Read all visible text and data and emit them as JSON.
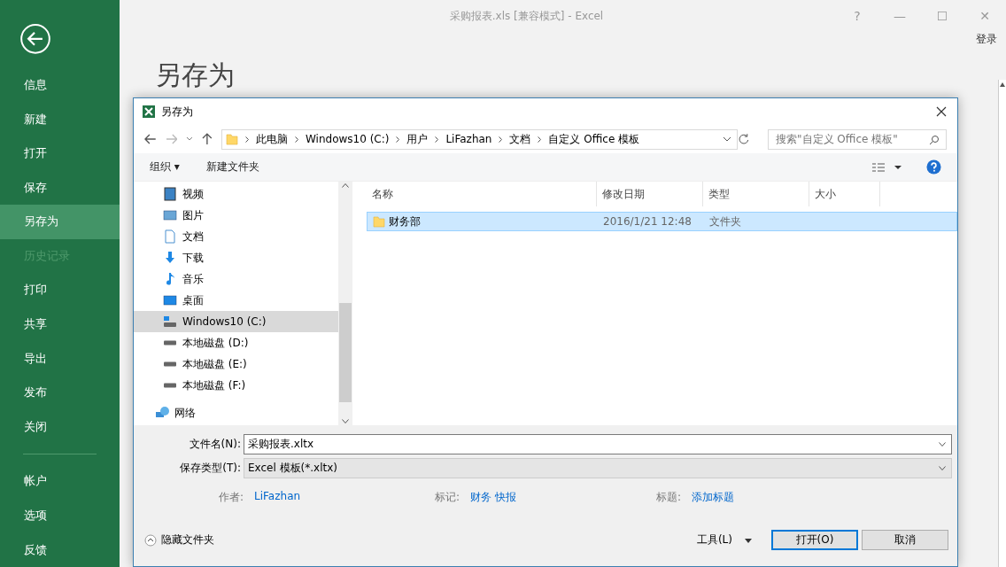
{
  "window": {
    "title": "采购报表.xls  [兼容模式] - Excel",
    "controls": [
      "?",
      "—",
      "☐",
      "✕"
    ],
    "sign_in": "登录"
  },
  "backstage": {
    "items": [
      {
        "label": "信息",
        "selected": false,
        "disabled": false
      },
      {
        "label": "新建",
        "selected": false,
        "disabled": false
      },
      {
        "label": "打开",
        "selected": false,
        "disabled": false
      },
      {
        "label": "保存",
        "selected": false,
        "disabled": false
      },
      {
        "label": "另存为",
        "selected": true,
        "disabled": false
      },
      {
        "label": "历史记录",
        "selected": false,
        "disabled": true
      },
      {
        "label": "打印",
        "selected": false,
        "disabled": false
      },
      {
        "label": "共享",
        "selected": false,
        "disabled": false
      },
      {
        "label": "导出",
        "selected": false,
        "disabled": false
      },
      {
        "label": "发布",
        "selected": false,
        "disabled": false
      },
      {
        "label": "关闭",
        "selected": false,
        "disabled": false
      }
    ],
    "bottom_items": [
      {
        "label": "帐户",
        "selected": false,
        "disabled": false
      },
      {
        "label": "选项",
        "selected": false,
        "disabled": false
      },
      {
        "label": "反馈",
        "selected": false,
        "disabled": false
      }
    ]
  },
  "heading": "另存为",
  "dialog": {
    "title": "另存为",
    "breadcrumb": [
      "此电脑",
      "Windows10 (C:)",
      "用户",
      "LiFazhan",
      "文档",
      "自定义 Office 模板"
    ],
    "search": {
      "placeholder": "搜索\"自定义 Office 模板\""
    },
    "toolbar": {
      "organize": "组织 ▾",
      "new_folder": "新建文件夹"
    },
    "nav": [
      {
        "label": "视频",
        "kind": "video",
        "selected": false
      },
      {
        "label": "图片",
        "kind": "picture",
        "selected": false
      },
      {
        "label": "文档",
        "kind": "doc",
        "selected": false
      },
      {
        "label": "下载",
        "kind": "download",
        "selected": false
      },
      {
        "label": "音乐",
        "kind": "music",
        "selected": false
      },
      {
        "label": "桌面",
        "kind": "desktop",
        "selected": false
      },
      {
        "label": "Windows10 (C:)",
        "kind": "windrive",
        "selected": true
      },
      {
        "label": "本地磁盘 (D:)",
        "kind": "drive",
        "selected": false
      },
      {
        "label": "本地磁盘 (E:)",
        "kind": "drive",
        "selected": false
      },
      {
        "label": "本地磁盘 (F:)",
        "kind": "drive",
        "selected": false
      },
      {
        "label": "网络",
        "kind": "network",
        "selected": false
      }
    ],
    "columns": [
      "名称",
      "修改日期",
      "类型",
      "大小"
    ],
    "rows": [
      {
        "name": "财务部",
        "date": "2016/1/21 12:48",
        "type": "文件夹",
        "size": "",
        "selected": true
      }
    ],
    "filename": {
      "label": "文件名(N):",
      "value": "采购报表.xltx"
    },
    "filetype": {
      "label": "保存类型(T):",
      "value": "Excel 模板(*.xltx)"
    },
    "meta": [
      {
        "label": "作者:",
        "value": "LiFazhan"
      },
      {
        "label": "标记:",
        "value": "财务 快报"
      },
      {
        "label": "标题:",
        "value": "添加标题"
      }
    ],
    "hide_folders": "隐藏文件夹",
    "tools": "工具(L)",
    "buttons": [
      "打开(O)",
      "取消"
    ]
  }
}
